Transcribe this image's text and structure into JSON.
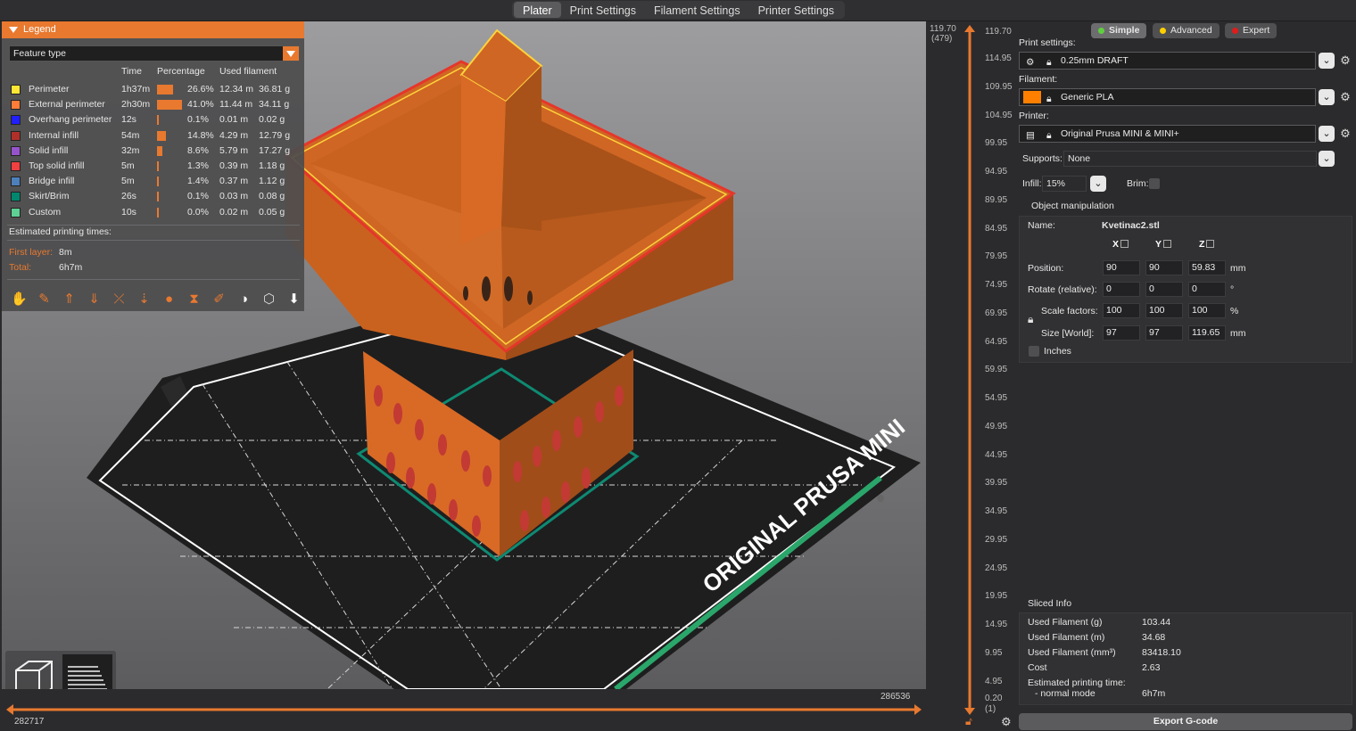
{
  "tabs": [
    "Plater",
    "Print Settings",
    "Filament Settings",
    "Printer Settings"
  ],
  "active_tab": "Plater",
  "accent_color": "#e8792f",
  "legend": {
    "title": "Legend",
    "view_type": "Feature type",
    "headers": {
      "time": "Time",
      "percentage": "Percentage",
      "used_filament": "Used filament"
    },
    "rows": [
      {
        "color": "#ffe634",
        "name": "Perimeter",
        "time": "1h37m",
        "percent_value": 26.6,
        "percent": "26.6%",
        "length": "12.34 m",
        "weight": "36.81 g"
      },
      {
        "color": "#ff7d38",
        "name": "External perimeter",
        "time": "2h30m",
        "percent_value": 41.0,
        "percent": "41.0%",
        "length": "11.44 m",
        "weight": "34.11 g"
      },
      {
        "color": "#1f1fff",
        "name": "Overhang perimeter",
        "time": "12s",
        "percent_value": 0.1,
        "percent": "0.1%",
        "length": "0.01 m",
        "weight": "0.02 g"
      },
      {
        "color": "#b03029",
        "name": "Internal infill",
        "time": "54m",
        "percent_value": 14.8,
        "percent": "14.8%",
        "length": "4.29 m",
        "weight": "12.79 g"
      },
      {
        "color": "#9654cc",
        "name": "Solid infill",
        "time": "32m",
        "percent_value": 8.6,
        "percent": "8.6%",
        "length": "5.79 m",
        "weight": "17.27 g"
      },
      {
        "color": "#f04040",
        "name": "Top solid infill",
        "time": "5m",
        "percent_value": 1.3,
        "percent": "1.3%",
        "length": "0.39 m",
        "weight": "1.18 g"
      },
      {
        "color": "#4d80ba",
        "name": "Bridge infill",
        "time": "5m",
        "percent_value": 1.4,
        "percent": "1.4%",
        "length": "0.37 m",
        "weight": "1.12 g"
      },
      {
        "color": "#00876e",
        "name": "Skirt/Brim",
        "time": "26s",
        "percent_value": 0.1,
        "percent": "0.1%",
        "length": "0.03 m",
        "weight": "0.08 g"
      },
      {
        "color": "#5ed194",
        "name": "Custom",
        "time": "10s",
        "percent_value": 0.0,
        "percent": "0.0%",
        "length": "0.02 m",
        "weight": "0.05 g"
      }
    ],
    "estimated_title": "Estimated printing times:",
    "first_layer_label": "First layer:",
    "first_layer_value": "8m",
    "total_label": "Total:",
    "total_value": "6h7m"
  },
  "bed_label": "ORIGINAL PRUSA MINI",
  "h_slider": {
    "right_value": "286536",
    "left_value": "282717"
  },
  "v_slider": {
    "top_value": "119.70",
    "top_layer": "(479)",
    "bottom_value": "0.20",
    "bottom_layer": "(1)",
    "ticks": [
      "119.70",
      "114.95",
      "109.95",
      "104.95",
      "99.95",
      "94.95",
      "89.95",
      "84.95",
      "79.95",
      "74.95",
      "69.95",
      "64.95",
      "59.95",
      "54.95",
      "49.95",
      "44.95",
      "39.95",
      "34.95",
      "29.95",
      "24.95",
      "19.95",
      "14.95",
      "9.95",
      "4.95",
      "0.20"
    ]
  },
  "panel": {
    "modes": [
      {
        "label": "Simple",
        "color": "#5fd03d"
      },
      {
        "label": "Advanced",
        "color": "#ffcf00"
      },
      {
        "label": "Expert",
        "color": "#e01b1b"
      }
    ],
    "print_settings_label": "Print settings:",
    "print_settings_value": "0.25mm DRAFT",
    "filament_label": "Filament:",
    "filament_value": "Generic PLA",
    "filament_color": "#ff8000",
    "printer_label": "Printer:",
    "printer_value": "Original Prusa MINI & MINI+",
    "supports_label": "Supports:",
    "supports_value": "None",
    "infill_label": "Infill:",
    "infill_value": "15%",
    "brim_label": "Brim:",
    "object_manipulation_title": "Object manipulation",
    "name_label": "Name:",
    "name_value": "Kvetinac2.stl",
    "axes": [
      "X",
      "Y",
      "Z"
    ],
    "position_label": "Position:",
    "position": [
      "90",
      "90",
      "59.83"
    ],
    "position_unit": "mm",
    "rotate_label": "Rotate (relative):",
    "rotate": [
      "0",
      "0",
      "0"
    ],
    "rotate_unit": "°",
    "scale_label": "Scale factors:",
    "scale": [
      "100",
      "100",
      "100"
    ],
    "scale_unit": "%",
    "size_label": "Size [World]:",
    "size": [
      "97",
      "97",
      "119.65"
    ],
    "size_unit": "mm",
    "inches_label": "Inches",
    "sliced_info_title": "Sliced Info",
    "sliced_info": [
      {
        "label": "Used Filament (g)",
        "value": "103.44"
      },
      {
        "label": "Used Filament (m)",
        "value": "34.68"
      },
      {
        "label": "Used Filament (mm³)",
        "value": "83418.10"
      },
      {
        "label": "Cost",
        "value": "2.63"
      }
    ],
    "est_time_label": "Estimated printing time:",
    "est_time_mode": "- normal mode",
    "est_time_value": "6h7m",
    "export_label": "Export G-code"
  }
}
